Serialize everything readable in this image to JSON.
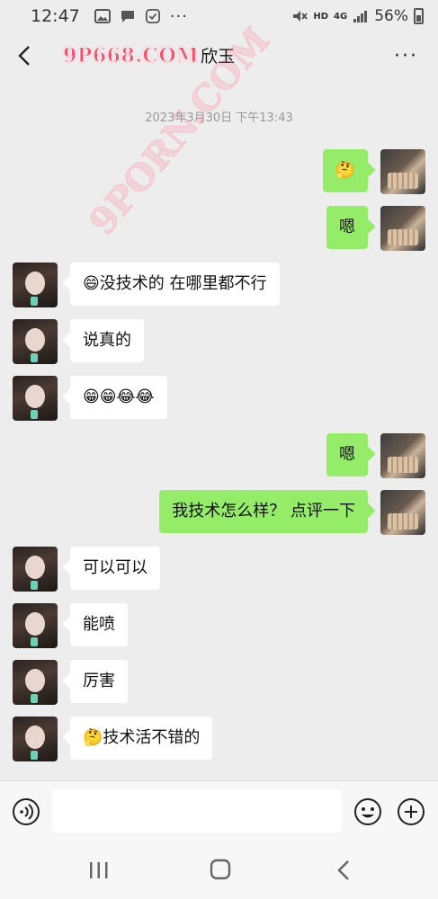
{
  "status_bar": {
    "time": "12:47",
    "network_hd": "HD",
    "network_4g": "4G",
    "battery": "56%"
  },
  "header": {
    "watermark_logo": "9P668.COM",
    "title": "欣玉",
    "more": "···"
  },
  "watermark_diagonal": "9PORN.COM",
  "timestamp": "2023年3月30日 下午13:43",
  "messages": [
    {
      "side": "right",
      "text": "🤔"
    },
    {
      "side": "right",
      "text": "嗯"
    },
    {
      "side": "left",
      "text": "😄没技术的 在哪里都不行"
    },
    {
      "side": "left",
      "text": "说真的"
    },
    {
      "side": "left",
      "text": "😁😁😂😂"
    },
    {
      "side": "right",
      "text": "嗯"
    },
    {
      "side": "right",
      "text": "我技术怎么样？ 点评一下"
    },
    {
      "side": "left",
      "text": "可以可以"
    },
    {
      "side": "left",
      "text": "能喷"
    },
    {
      "side": "left",
      "text": "厉害"
    },
    {
      "side": "left",
      "text": "🤔技术活不错的"
    }
  ],
  "input": {
    "value": "",
    "placeholder": ""
  },
  "icons": {
    "voice": "voice-icon",
    "emoji": "emoji-icon",
    "plus": "plus-icon",
    "back": "back-icon",
    "more": "more-icon"
  },
  "colors": {
    "bubble_self": "#95ec69",
    "bubble_other": "#ffffff",
    "background": "#ededed"
  }
}
